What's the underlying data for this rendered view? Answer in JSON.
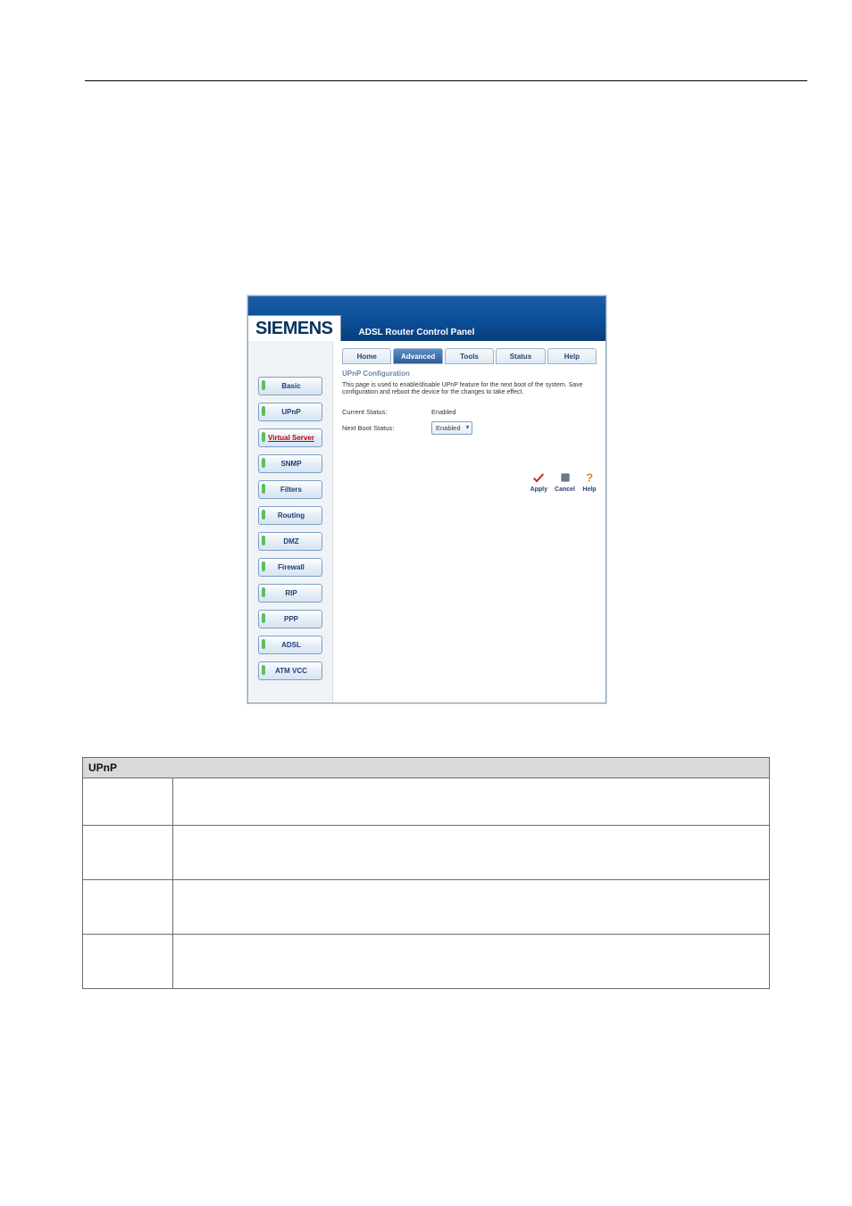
{
  "sidebar": {
    "items": [
      {
        "label": "Basic"
      },
      {
        "label": "UPnP"
      },
      {
        "label": "Virtual Server"
      },
      {
        "label": "SNMP"
      },
      {
        "label": "Filters"
      },
      {
        "label": "Routing"
      },
      {
        "label": "DMZ"
      },
      {
        "label": "Firewall"
      },
      {
        "label": "RIP"
      },
      {
        "label": "PPP"
      },
      {
        "label": "ADSL"
      },
      {
        "label": "ATM VCC"
      }
    ]
  },
  "logo": "SIEMENS",
  "header_title": "ADSL Router Control Panel",
  "tabs": {
    "home": "Home",
    "advanced": "Advanced",
    "tools": "Tools",
    "status": "Status",
    "help": "Help"
  },
  "main": {
    "section_title": "UPnP Configuration",
    "description": "This page is used to enable/disable UPnP feature for the next boot of the system. Save configuration and reboot the device for the changes to take effect.",
    "current_status_label": "Current Status:",
    "current_status_value": "Enabled",
    "next_boot_label": "Next Boot Status:",
    "next_boot_value": "Enabled"
  },
  "actions": {
    "apply": "Apply",
    "cancel": "Cancel",
    "help": "Help"
  },
  "table": {
    "header": "UPnP"
  }
}
